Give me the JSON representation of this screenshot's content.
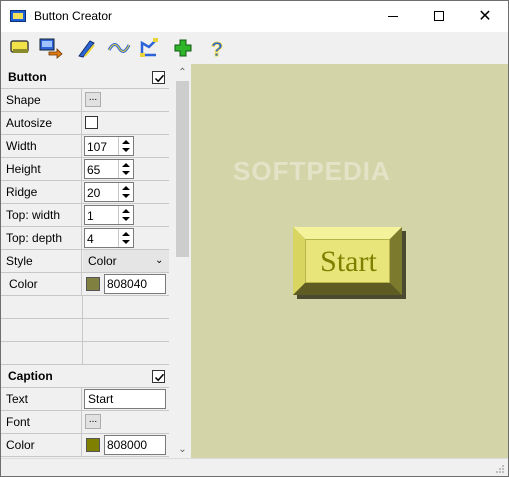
{
  "window": {
    "title": "Button Creator",
    "close_glyph": "✕"
  },
  "toolbar": {
    "tools": [
      {
        "name": "new-button-icon"
      },
      {
        "name": "export-icon"
      },
      {
        "name": "pen-icon"
      },
      {
        "name": "wave-icon"
      },
      {
        "name": "shape-edit-icon"
      },
      {
        "name": "add-icon"
      },
      {
        "name": "help-icon"
      }
    ]
  },
  "button_section": {
    "title": "Button",
    "enabled": true,
    "rows": {
      "shape": {
        "label": "Shape",
        "btn": "..."
      },
      "autosize": {
        "label": "Autosize",
        "checked": false
      },
      "width": {
        "label": "Width",
        "value": "107"
      },
      "height": {
        "label": "Height",
        "value": "65"
      },
      "ridge": {
        "label": "Ridge",
        "value": "20"
      },
      "top_width": {
        "label": "Top: width",
        "value": "1"
      },
      "top_depth": {
        "label": "Top: depth",
        "value": "4"
      },
      "style": {
        "label": "Style",
        "value": "Color"
      },
      "color": {
        "label": "Color",
        "value": "808040",
        "swatch": "#808040"
      }
    }
  },
  "caption_section": {
    "title": "Caption",
    "enabled": true,
    "rows": {
      "text": {
        "label": "Text",
        "value": "Start"
      },
      "font": {
        "label": "Font",
        "btn": "..."
      },
      "color": {
        "label": "Color",
        "value": "808000",
        "swatch": "#808000"
      }
    }
  },
  "preview": {
    "background": "#d4d4a9",
    "watermark": "SOFTPEDIA",
    "button_caption": "Start"
  }
}
